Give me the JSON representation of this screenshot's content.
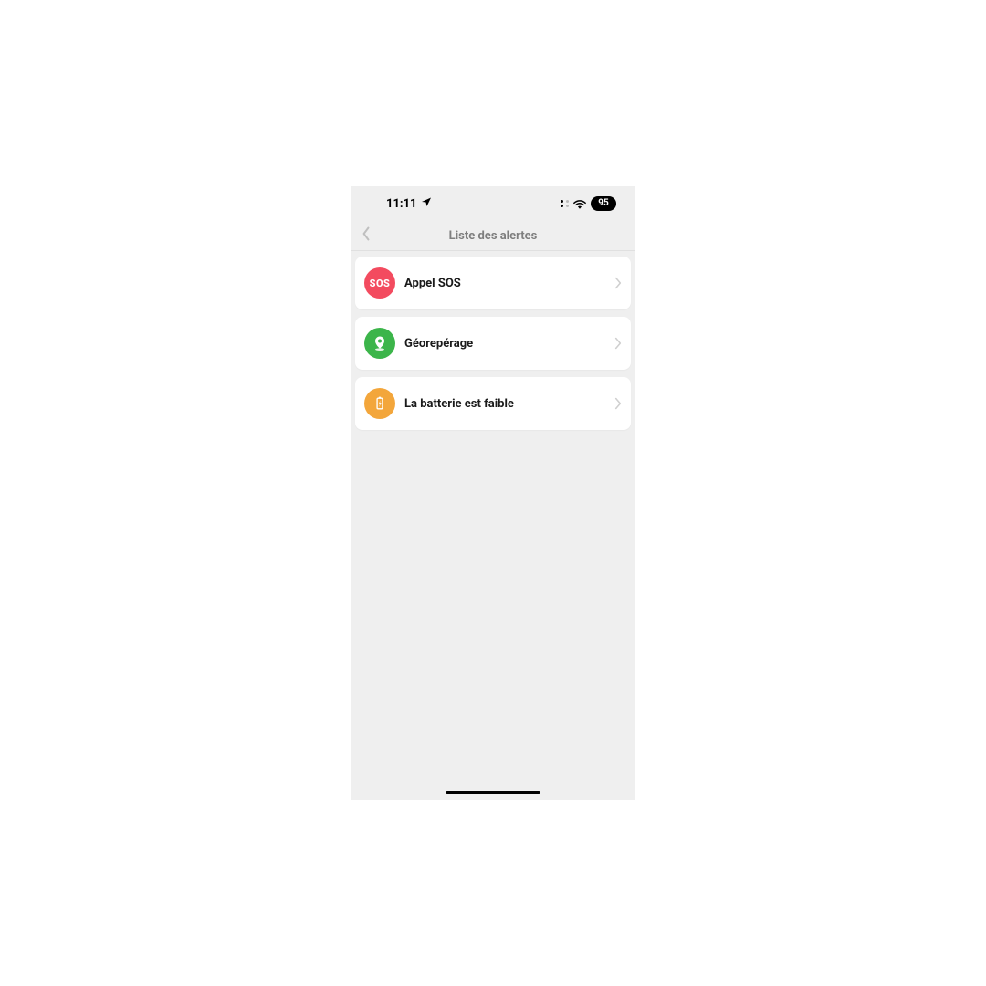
{
  "statusbar": {
    "time": "11:11",
    "battery": "95"
  },
  "nav": {
    "title": "Liste des alertes"
  },
  "list": {
    "items": [
      {
        "label": "Appel SOS",
        "icon": "sos",
        "icon_text": "SOS",
        "color": "#f34b5f"
      },
      {
        "label": "Géorepérage",
        "icon": "geo",
        "color": "#3cb54a"
      },
      {
        "label": "La batterie est faible",
        "icon": "battery",
        "color": "#f3a63b"
      }
    ]
  }
}
